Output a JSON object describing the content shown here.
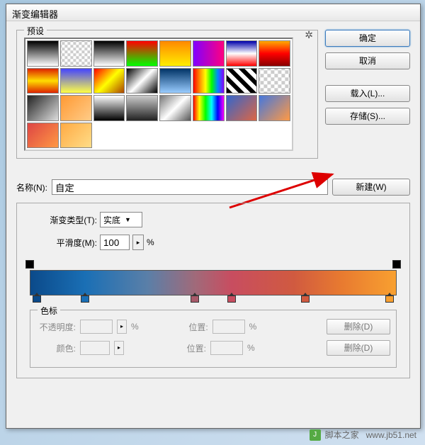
{
  "window": {
    "title": "渐变编辑器"
  },
  "presets": {
    "legend": "预设",
    "gear_icon": "gear",
    "swatches": [
      "linear-gradient(#000,#fff)",
      "repeating-conic-gradient(#ccc 0 25%, #fff 0 50%) 50%/8px 8px",
      "linear-gradient(#000,#fff)",
      "linear-gradient(#ff0000,#00ff00)",
      "linear-gradient(#ff8800,#ffee00)",
      "linear-gradient(90deg,#8000ff,#ff0080)",
      "linear-gradient(#0000aa,#ffffff,#ff0000)",
      "linear-gradient(#ffaa00,#ff0000,#880000)",
      "linear-gradient(#dd2200,#ffdd00,#dd2200)",
      "linear-gradient(#4444ff,#ffff44)",
      "linear-gradient(135deg,#ff0000,#ffff00,#aa4400)",
      "linear-gradient(135deg,#000,#fff,#000)",
      "linear-gradient(#003366,#99ccff)",
      "linear-gradient(90deg,#ff0000,#ff8800,#ffff00,#00ff00,#0088ff,#8800ff)",
      "repeating-linear-gradient(45deg,#000 0 6px,#fff 6px 12px)",
      "repeating-conic-gradient(#fff 0 25%, #ccc 0 50%) 50%/10px 10px",
      "linear-gradient(135deg,#222,#ddd)",
      "linear-gradient(135deg,#ff9933,#ffcc88)",
      "linear-gradient(#fff,#000)",
      "linear-gradient(#ccc,#222)",
      "linear-gradient(135deg,#777,#fff,#555)",
      "linear-gradient(90deg,#ff0000,#ffff00,#00ff00,#00ffff,#0000ff,#ff00ff)",
      "linear-gradient(135deg,#3366cc,#dd6644)",
      "linear-gradient(135deg,#4477dd,#ff9944)",
      "linear-gradient(135deg,#dd4444,#ff9944)",
      "linear-gradient(135deg,#ffaa44,#ffdd88)"
    ]
  },
  "buttons": {
    "ok": "确定",
    "cancel": "取消",
    "load": "载入(L)...",
    "save": "存储(S)...",
    "new": "新建(W)"
  },
  "name": {
    "label": "名称(N):",
    "value": "自定"
  },
  "gradient": {
    "type_label": "渐变类型(T):",
    "type_value": "实底",
    "smooth_label": "平滑度(M):",
    "smooth_value": "100",
    "pct": "%",
    "opacity_stops": [
      0,
      100
    ],
    "color_stops": [
      {
        "pos": 2,
        "color": "#0b4a8a"
      },
      {
        "pos": 15,
        "color": "#1a6fb5"
      },
      {
        "pos": 45,
        "color": "#a85a6a"
      },
      {
        "pos": 55,
        "color": "#c84d60"
      },
      {
        "pos": 75,
        "color": "#d05a40"
      },
      {
        "pos": 98,
        "color": "#f8a030"
      }
    ]
  },
  "stops_panel": {
    "legend": "色标",
    "opacity_label": "不透明度:",
    "position_label": "位置:",
    "color_label": "颜色:",
    "pct": "%",
    "delete": "删除(D)"
  },
  "footer": {
    "text": "脚本之家",
    "url": "www.jb51.net"
  }
}
